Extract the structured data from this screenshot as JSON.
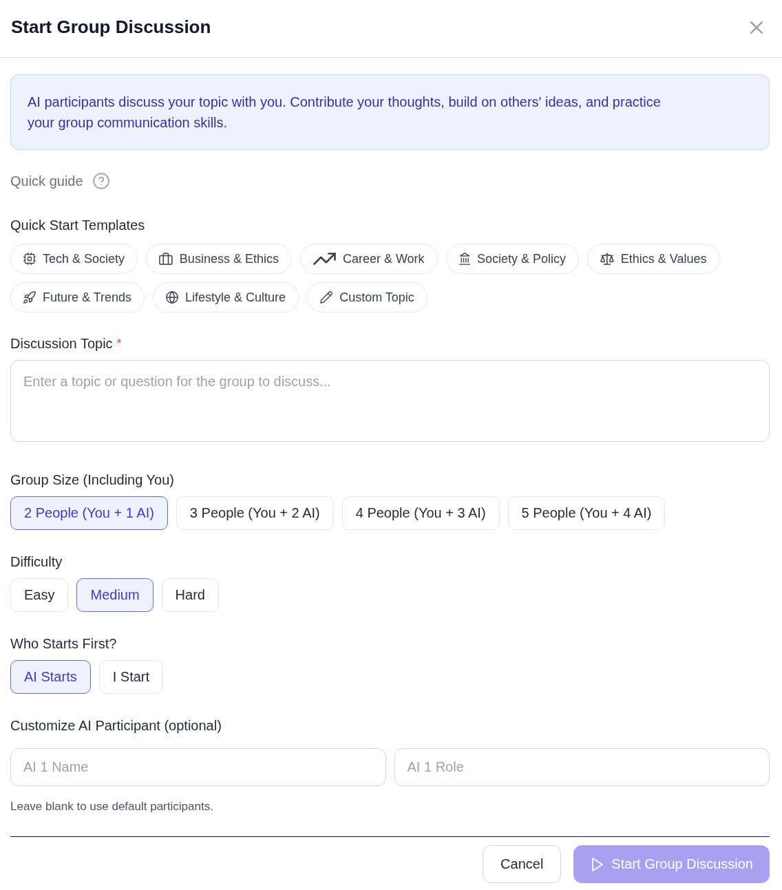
{
  "dialog": {
    "title": "Start Group Discussion"
  },
  "info_banner": {
    "text": "AI participants discuss your topic with you. Contribute your thoughts, build on others' ideas, and practice your group communication skills."
  },
  "quick_guide": {
    "label": "Quick guide"
  },
  "templates": {
    "label": "Quick Start Templates",
    "items": [
      {
        "label": "Tech & Society"
      },
      {
        "label": "Business & Ethics"
      },
      {
        "label": "Career & Work"
      },
      {
        "label": "Society & Policy"
      },
      {
        "label": "Ethics & Values"
      },
      {
        "label": "Future & Trends"
      },
      {
        "label": "Lifestyle & Culture"
      },
      {
        "label": "Custom Topic"
      }
    ]
  },
  "topic": {
    "label": "Discussion Topic",
    "required_mark": "*",
    "placeholder": "Enter a topic or question for the group to discuss..."
  },
  "group_size": {
    "label": "Group Size (Including You)",
    "options": [
      {
        "label": "2 People (You + 1 AI)",
        "selected": true
      },
      {
        "label": "3 People (You + 2 AI)",
        "selected": false
      },
      {
        "label": "4 People (You + 3 AI)",
        "selected": false
      },
      {
        "label": "5 People (You + 4 AI)",
        "selected": false
      }
    ]
  },
  "difficulty": {
    "label": "Difficulty",
    "options": [
      {
        "label": "Easy",
        "selected": false
      },
      {
        "label": "Medium",
        "selected": true
      },
      {
        "label": "Hard",
        "selected": false
      }
    ]
  },
  "who_starts": {
    "label": "Who Starts First?",
    "options": [
      {
        "label": "AI Starts",
        "selected": true
      },
      {
        "label": "I Start",
        "selected": false
      }
    ]
  },
  "customize": {
    "label": "Customize AI Participant (optional)",
    "fields": [
      {
        "placeholder": "AI 1 Name"
      },
      {
        "placeholder": "AI 1 Role"
      }
    ],
    "hint": "Leave blank to use default participants."
  },
  "footer": {
    "buttons": [
      {
        "label": "Cancel",
        "kind": "secondary",
        "disabled": false
      },
      {
        "label": "Start Group Discussion",
        "kind": "primary",
        "disabled": true
      }
    ]
  }
}
